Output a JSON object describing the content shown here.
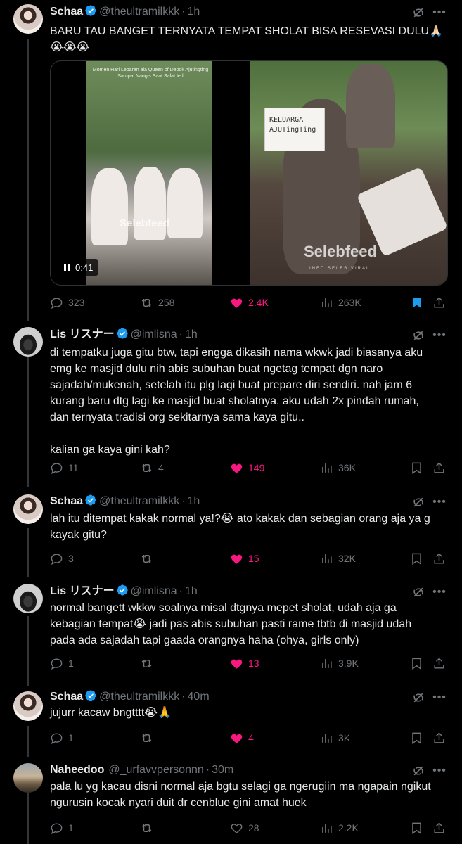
{
  "tweets": [
    {
      "name": "Schaa",
      "handle": "@theultramilkkk",
      "time": "1h",
      "text": "BARU TAU BANGET TERNYATA TEMPAT SHOLAT BISA RESEVASI DULU🙏🏻\n😭😭😭",
      "media": {
        "caption": "Momen Hari Lebaran ala Queen of Depok Ajutingting Sampai Nangis Saat Salat Ied",
        "sign_text": "KELUARGA\nAJUTingTing",
        "watermark": "Selebfeed",
        "watermark_sub": "INFO SELEB VIRAL",
        "duration": "0:41"
      },
      "stats": {
        "replies": "323",
        "reposts": "258",
        "likes": "2.4K",
        "views": "263K"
      },
      "liked": true,
      "bookmarked": true
    },
    {
      "name": "Lis リスナー",
      "handle": "@imlisna",
      "time": "1h",
      "text": "di tempatku juga gitu btw, tapi engga dikasih nama wkwk jadi biasanya aku\nemg ke masjid dulu nih abis subuhan buat ngetag tempat dgn naro\nsajadah/mukenah, setelah itu plg lagi buat prepare diri sendiri. nah jam 6\nkurang baru dtg lagi ke masjid buat sholatnya. aku udah 2x pindah rumah,\ndan ternyata tradisi org sekitarnya sama kaya gitu..\n\nkalian ga kaya gini kah?",
      "stats": {
        "replies": "11",
        "reposts": "4",
        "likes": "149",
        "views": "36K"
      },
      "liked": true,
      "bookmarked": false
    },
    {
      "name": "Schaa",
      "handle": "@theultramilkkk",
      "time": "1h",
      "text": "lah itu ditempat kakak normal ya!?😭 ato kakak dan sebagian orang aja ya g\nkayak gitu?",
      "stats": {
        "replies": "3",
        "reposts": "",
        "likes": "15",
        "views": "32K"
      },
      "liked": true,
      "bookmarked": false
    },
    {
      "name": "Lis リスナー",
      "handle": "@imlisna",
      "time": "1h",
      "text": "normal bangett wkkw soalnya misal dtgnya mepet sholat, udah aja ga\nkebagian tempat😭 jadi pas abis subuhan pasti rame tbtb di masjid udah\npada ada sajadah tapi gaada orangnya haha (ohya, girls only)",
      "stats": {
        "replies": "1",
        "reposts": "",
        "likes": "13",
        "views": "3.9K"
      },
      "liked": true,
      "bookmarked": false
    },
    {
      "name": "Schaa",
      "handle": "@theultramilkkk",
      "time": "40m",
      "text": "jujurr kacaw bngtttt😭🙏",
      "stats": {
        "replies": "1",
        "reposts": "",
        "likes": "4",
        "views": "3K"
      },
      "liked": true,
      "bookmarked": false
    },
    {
      "name": "Naheedoo",
      "handle": "@_urfavvpersonnn",
      "time": "30m",
      "text": "pala lu yg kacau disni normal aja bgtu selagi ga ngerugiin ma ngapain ngikut\nngurusin kocak nyari duit dr cenblue gini amat huek",
      "stats": {
        "replies": "1",
        "reposts": "",
        "likes": "28",
        "views": "2.2K"
      },
      "liked": false,
      "bookmarked": false
    }
  ],
  "colors": {
    "background": "#000000",
    "text": "#e7e9ea",
    "muted": "#71767b",
    "like": "#f91880",
    "verified": "#1d9bf0",
    "bookmark": "#1d9bf0"
  },
  "icons": [
    "verified-badge-icon",
    "grok-icon",
    "more-icon",
    "reply-icon",
    "repost-icon",
    "like-icon",
    "views-icon",
    "bookmark-icon",
    "share-icon",
    "pause-icon"
  ]
}
